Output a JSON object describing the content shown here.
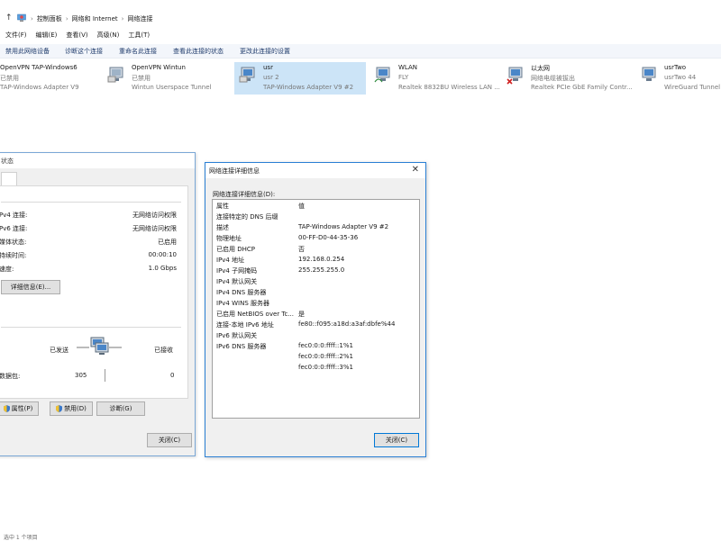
{
  "address": {
    "crumbs": [
      "控制面板",
      "网络和 Internet",
      "网络连接"
    ]
  },
  "menu": [
    "文件(F)",
    "编辑(E)",
    "查看(V)",
    "高级(N)",
    "工具(T)"
  ],
  "command_bar": [
    "禁用此网络设备",
    "诊断这个连接",
    "重命名此连接",
    "查看此连接的状态",
    "更改此连接的设置"
  ],
  "adapters": [
    {
      "name": "OpenVPN TAP-Windows6",
      "status": "已禁用",
      "device": "TAP-Windows Adapter V9",
      "icon": "network-adapter-icon"
    },
    {
      "name": "OpenVPN Wintun",
      "status": "已禁用",
      "device": "Wintun Userspace Tunnel",
      "icon": "network-adapter-icon"
    },
    {
      "name": "usr",
      "status": "usr 2",
      "device": "TAP-Windows Adapter V9 #2",
      "icon": "network-adapter-icon",
      "selected": true
    },
    {
      "name": "WLAN",
      "status": "FLY",
      "device": "Realtek 8832BU Wireless LAN ...",
      "icon": "wifi-adapter-icon"
    },
    {
      "name": "以太网",
      "status": "网络电缆被拔出",
      "device": "Realtek PCIe GbE Family Contr...",
      "icon": "ethernet-disconnected-icon"
    },
    {
      "name": "usrTwo",
      "status": "usrTwo 44",
      "device": "WireGuard Tunnel",
      "icon": "network-adapter-icon"
    }
  ],
  "status_window": {
    "title": "状态",
    "rows": [
      {
        "label": "Pv4 连接:",
        "value": "无网络访问权限"
      },
      {
        "label": "Pv6 连接:",
        "value": "无网络访问权限"
      },
      {
        "label": "媒体状态:",
        "value": "已启用"
      },
      {
        "label": "持续时间:",
        "value": "00:00:10"
      },
      {
        "label": "速度:",
        "value": "1.0 Gbps"
      }
    ],
    "details_button": "详细信息(E)...",
    "activity": {
      "sent_label": "已发送",
      "received_label": "已接收",
      "packets_label": "数据包:",
      "sent_value": "305",
      "received_value": "0"
    },
    "buttons": {
      "properties": "属性(P)",
      "disable": "禁用(D)",
      "diagnose": "诊断(G)",
      "close": "关闭(C)"
    }
  },
  "details_window": {
    "title": "网络连接详细信息",
    "caption": "网络连接详细信息(D):",
    "columns": [
      "属性",
      "值"
    ],
    "rows": [
      {
        "prop": "连接特定的 DNS 后缀",
        "value": ""
      },
      {
        "prop": "描述",
        "value": "TAP-Windows Adapter V9 #2"
      },
      {
        "prop": "物理地址",
        "value": "00-FF-D0-44-35-36"
      },
      {
        "prop": "已启用 DHCP",
        "value": "否"
      },
      {
        "prop": "IPv4 地址",
        "value": "192.168.0.254"
      },
      {
        "prop": "IPv4 子网掩码",
        "value": "255.255.255.0"
      },
      {
        "prop": "IPv4 默认网关",
        "value": ""
      },
      {
        "prop": "IPv4 DNS 服务器",
        "value": ""
      },
      {
        "prop": "IPv4 WINS 服务器",
        "value": ""
      },
      {
        "prop": "已启用 NetBIOS over Tc...",
        "value": "是"
      },
      {
        "prop": "连接-本地 IPv6 地址",
        "value": "fe80::f095:a18d:a3af:dbfe%44"
      },
      {
        "prop": "IPv6 默认网关",
        "value": ""
      },
      {
        "prop": "IPv6 DNS 服务器",
        "value": "fec0:0:0:ffff::1%1"
      },
      {
        "prop": "",
        "value": "fec0:0:0:ffff::2%1"
      },
      {
        "prop": "",
        "value": "fec0:0:0:ffff::3%1"
      }
    ],
    "close_button": "关闭(C)"
  },
  "status_bar": "选中 1 个项目",
  "colors": {
    "selection": "#cce4f7",
    "window_border": "#2a7fd4",
    "command_text": "#1e3a6b"
  }
}
